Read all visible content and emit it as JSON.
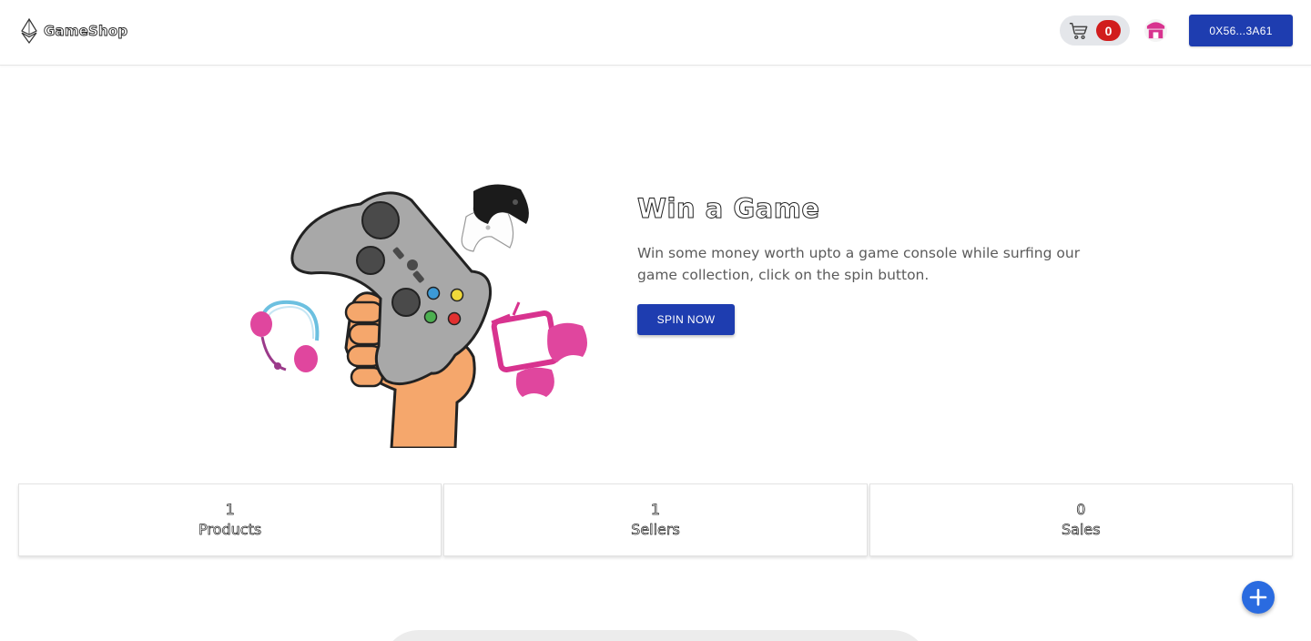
{
  "header": {
    "brand_name": "GameShop",
    "cart_count": "0",
    "wallet_label": "0X56...3A61"
  },
  "hero": {
    "title": "Win a Game",
    "description": "Win some money worth upto a game console while surfing our game collection, click on the spin button.",
    "button_label": "SPIN NOW"
  },
  "stats": [
    {
      "value": "1",
      "label": "Products"
    },
    {
      "value": "1",
      "label": "Sellers"
    },
    {
      "value": "0",
      "label": "Sales"
    }
  ],
  "icons": {
    "brand": "ethereum-logo-icon",
    "cart": "cart-icon",
    "avatar": "store-avatar-icon",
    "fab": "plus-icon"
  },
  "colors": {
    "primary": "#1e3db0",
    "badge": "#d11d1d",
    "fab": "#2a6be0",
    "accent_pink": "#d8338f"
  }
}
